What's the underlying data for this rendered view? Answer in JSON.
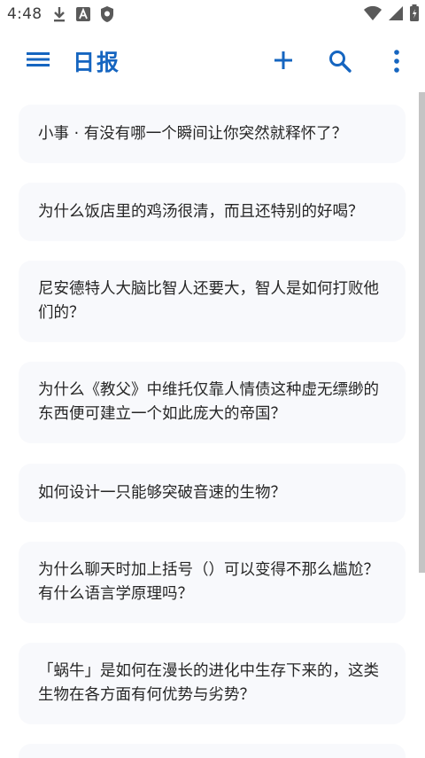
{
  "status_bar": {
    "time": "4:48",
    "icons": [
      "download-icon",
      "a-badge-icon",
      "shield-icon",
      "wifi-icon",
      "signal-icon",
      "battery-icon"
    ]
  },
  "app_bar": {
    "title": "日报",
    "accent_color": "#1565c0",
    "icons": [
      "menu-icon",
      "add-icon",
      "search-icon",
      "more-vert-icon"
    ]
  },
  "feed": {
    "items": [
      {
        "title": "小事 · 有没有哪一个瞬间让你突然就释怀了？"
      },
      {
        "title": "为什么饭店里的鸡汤很清，而且还特别的好喝？"
      },
      {
        "title": "尼安德特人大脑比智人还要大，智人是如何打败他们的？"
      },
      {
        "title": "为什么《教父》中维托仅靠人情债这种虚无缥缈的东西便可建立一个如此庞大的帝国？"
      },
      {
        "title": "如何设计一只能够突破音速的生物？"
      },
      {
        "title": "为什么聊天时加上括号（）可以变得不那么尴尬？有什么语言学原理吗？"
      },
      {
        "title": "「蜗牛」是如何在漫长的进化中生存下来的，这类生物在各方面有何优势与劣势？"
      },
      {
        "title": ""
      }
    ]
  }
}
